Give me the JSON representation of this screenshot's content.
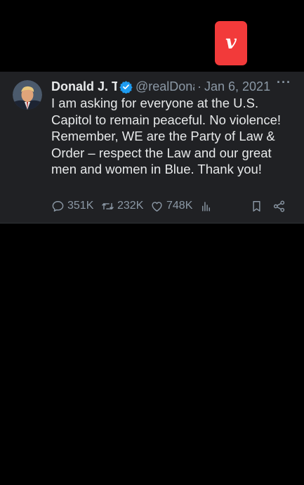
{
  "badge": {
    "letter": "v",
    "color": "#f23a3a"
  },
  "tweet": {
    "author_name": "Donald J. Trump",
    "handle": "@realDonaldTrump",
    "separator": "·",
    "date": "Jan 6, 2021",
    "more": "···",
    "text": "I am asking for everyone at the U.S. Capitol to remain peaceful. No violence! Remember, WE are the Party of Law & Order – respect the Law and our great men and women in Blue. Thank you!",
    "verified_color": "#1d9bf0"
  },
  "actions": {
    "replies": "351K",
    "retweets": "232K",
    "likes": "748K"
  },
  "icons": [
    "reply-icon",
    "retweet-icon",
    "like-icon",
    "views-icon",
    "bookmark-icon",
    "share-icon",
    "verified-icon",
    "more-icon"
  ]
}
